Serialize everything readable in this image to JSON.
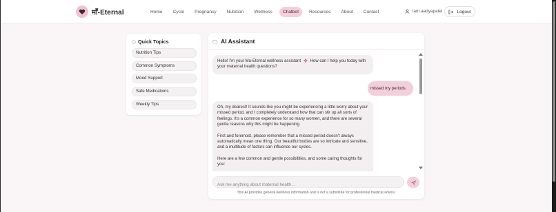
{
  "brand": {
    "name": "माँ-Eternal"
  },
  "nav": {
    "links": [
      "Home",
      "Cycle",
      "Pregnancy",
      "Nutrition",
      "Wellness",
      "Chatbot",
      "Resources",
      "About",
      "Contact"
    ],
    "active": "Chatbot"
  },
  "user": {
    "name": "iam.aadyapatel",
    "logout_label": "Logout"
  },
  "topics": {
    "title": "Quick Topics",
    "items": [
      "Nutrition Tips",
      "Common Symptoms",
      "Mood Support",
      "Safe Medications",
      "Weekly Tips"
    ]
  },
  "chat": {
    "title": "AI Assistant",
    "greeting_a": "Hello! I'm your Ma-Eternal wellness assistant",
    "greeting_b": "How can I help you today with your maternal health questions?",
    "user_message": "missed my periods",
    "reply_p1": "Oh, my dearest! It sounds like you might be experiencing a little worry about your missed period, and I completely understand how that can stir up all sorts of feelings. It's a common experience for so many women, and there are several gentle reasons why this might be happening.",
    "reply_p2": "First and foremost, please remember that a missed period doesn't always automatically mean one thing. Our beautiful bodies are so intricate and sensitive, and a multitude of factors can influence our cycles.",
    "reply_p3": "Here are a few common and gentle possibilities, and some caring thoughts for you:",
    "input_placeholder": "Ask me anything about maternal health...",
    "disclaimer": "This AI provides general wellness information and is not a substitute for professional medical advice."
  },
  "colors": {
    "accent": "#f2cfda",
    "heart": "#e26a8c",
    "icon_dark": "#3a2a30"
  }
}
